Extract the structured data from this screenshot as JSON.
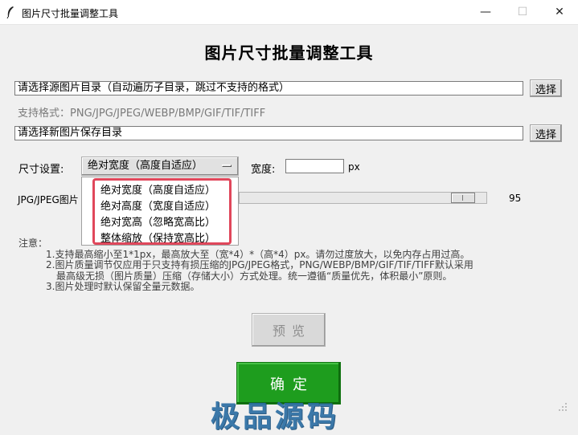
{
  "window": {
    "title": "图片尺寸批量调整工具",
    "controls": {
      "minimize": "—",
      "maximize": "☐",
      "close": "✕"
    }
  },
  "header": {
    "title": "图片尺寸批量调整工具"
  },
  "source": {
    "value": "请选择源图片目录（自动遍历子目录，跳过不支持的格式）",
    "button": "选择"
  },
  "formats_label": "支持格式：PNG/JPG/JPEG/WEBP/BMP/GIF/TIF/TIFF",
  "dest": {
    "value": "请选择新图片保存目录",
    "button": "选择"
  },
  "size": {
    "label": "尺寸设置:",
    "selected": "绝对宽度（高度自适应）",
    "options": [
      "绝对宽度（高度自适应）",
      "绝对高度（宽度自适应）",
      "绝对宽高（忽略宽高比）",
      "整体缩放（保持宽高比）"
    ],
    "width_label": "宽度:",
    "width_value": "",
    "unit": "px"
  },
  "quality": {
    "label": "JPG/JPEG图片",
    "value": 95,
    "value_text": "95",
    "fraction": 0.95
  },
  "notes": {
    "title": "注意：",
    "lines": [
      "1.支持最高缩小至1*1px，最高放大至（宽*4）*（高*4）px。请勿过度放大，以免内存占用过高。",
      "2.图片质量调节仅应用于只支持有损压缩的JPG/JPEG格式，PNG/WEBP/BMP/GIF/TIF/TIFF默认采用",
      "最高级无损（图片质量）压缩（存储大小）方式处理。统一遵循“质量优先，体积最小”原则。",
      "3.图片处理时默认保留全量元数据。"
    ]
  },
  "buttons": {
    "preview": "预览",
    "confirm": "确定"
  },
  "watermark": "极品源码",
  "colors": {
    "confirm": "#1e9d1e",
    "highlight_border": "#e0475b",
    "watermark": "#2c6ea3"
  }
}
